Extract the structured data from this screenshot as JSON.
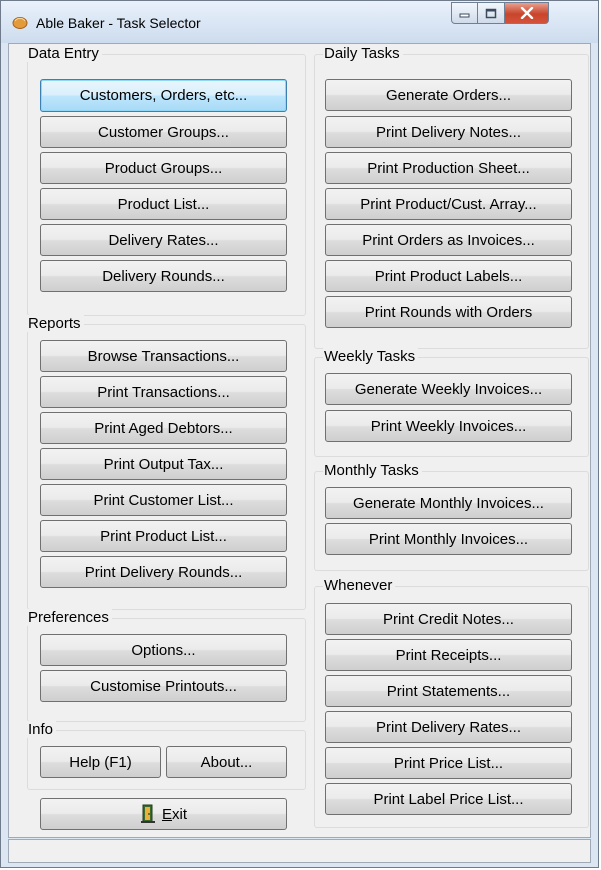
{
  "window": {
    "title": "Able Baker - Task Selector"
  },
  "data_entry": {
    "label": "Data Entry",
    "buttons": [
      "Customers, Orders, etc...",
      "Customer Groups...",
      "Product Groups...",
      "Product List...",
      "Delivery Rates...",
      "Delivery Rounds..."
    ]
  },
  "reports": {
    "label": "Reports",
    "buttons": [
      "Browse Transactions...",
      "Print Transactions...",
      "Print Aged Debtors...",
      "Print Output Tax...",
      "Print Customer List...",
      "Print Product List...",
      "Print Delivery Rounds..."
    ]
  },
  "preferences": {
    "label": "Preferences",
    "buttons": [
      "Options...",
      "Customise Printouts..."
    ]
  },
  "info": {
    "label": "Info",
    "help": "Help (F1)",
    "about": "About..."
  },
  "exit": {
    "mnemonic": "E",
    "rest": "xit"
  },
  "daily": {
    "label": "Daily Tasks",
    "buttons": [
      "Generate Orders...",
      "Print Delivery Notes...",
      "Print Production Sheet...",
      "Print Product/Cust. Array...",
      "Print Orders as Invoices...",
      "Print Product Labels...",
      "Print Rounds with Orders"
    ]
  },
  "weekly": {
    "label": "Weekly Tasks",
    "buttons": [
      "Generate Weekly Invoices...",
      "Print Weekly Invoices..."
    ]
  },
  "monthly": {
    "label": "Monthly Tasks",
    "buttons": [
      "Generate Monthly Invoices...",
      "Print Monthly Invoices..."
    ]
  },
  "whenever": {
    "label": "Whenever",
    "buttons": [
      "Print Credit Notes...",
      "Print Receipts...",
      "Print Statements...",
      "Print Delivery Rates...",
      "Print Price List...",
      "Print Label Price List..."
    ]
  },
  "status": {
    "text": ""
  },
  "colors": {
    "title_bg": "#dce6f2",
    "client_bg": "#f0f0f0",
    "close_red": "#c8452c",
    "default_border": "#3c7fb1"
  },
  "icons": {
    "app": "bread-icon",
    "exit": "exit-door-icon",
    "minimize": "minimize-icon",
    "maximize": "maximize-icon",
    "close": "close-icon"
  }
}
